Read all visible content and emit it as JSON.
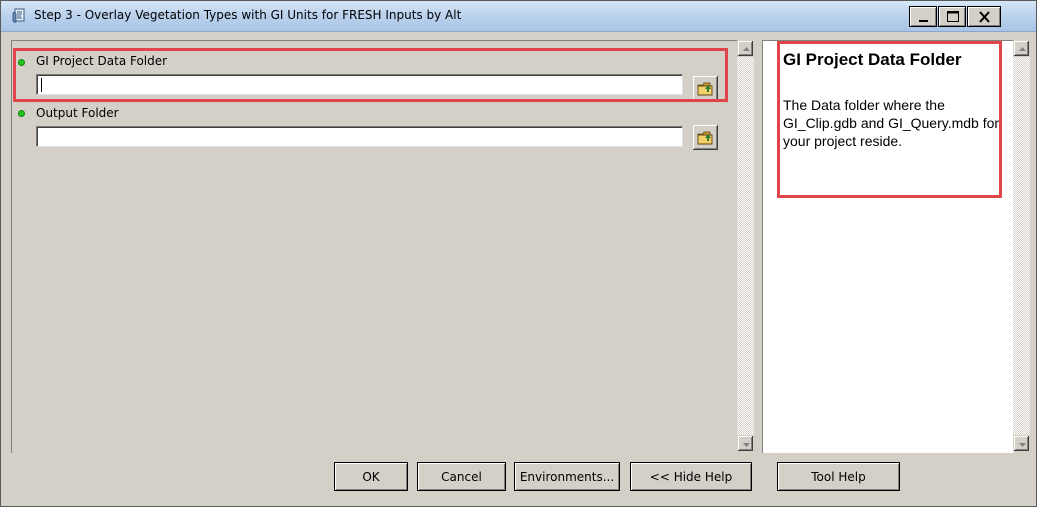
{
  "window": {
    "title": "Step 3 - Overlay Vegetation Types with GI Units for FRESH Inputs by Alt",
    "icon": "python-script-tool-icon"
  },
  "title_buttons": [
    "minimize",
    "maximize",
    "close"
  ],
  "parameters": [
    {
      "label": "GI Project Data Folder",
      "value": "",
      "required": true,
      "highlighted": true
    },
    {
      "label": "Output Folder",
      "value": "",
      "required": true,
      "highlighted": false
    }
  ],
  "help": {
    "title": "GI Project Data Folder",
    "body": "The Data folder where the GI_Clip.gdb and GI_Query.mdb for your project reside."
  },
  "buttons": {
    "ok": "OK",
    "cancel": "Cancel",
    "environments": "Environments...",
    "hide_help": "<< Hide Help",
    "tool_help": "Tool Help"
  },
  "colors": {
    "highlight": "#e0454a",
    "required_indicator": "#22c322",
    "dialog_background": "#d4d0c8"
  }
}
